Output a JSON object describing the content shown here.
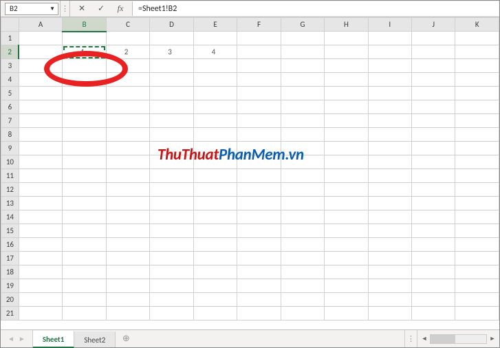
{
  "nameBox": {
    "value": "B2"
  },
  "formulaBar": {
    "cancel": "✕",
    "enter": "✓",
    "fx": "fx",
    "formula": "=Sheet1!B2"
  },
  "grid": {
    "columns": [
      "A",
      "B",
      "C",
      "D",
      "E",
      "F",
      "G",
      "H",
      "I",
      "J",
      "K"
    ],
    "rowCount": 21,
    "selectedCol": "B",
    "selectedRow": 2,
    "cells": {
      "B2": "1",
      "C2": "2",
      "D2": "3",
      "E2": "4"
    }
  },
  "watermark": {
    "part1": "ThuThuat",
    "part2": "PhanMem.vn"
  },
  "tabs": {
    "items": [
      {
        "label": "Sheet1",
        "active": true
      },
      {
        "label": "Sheet2",
        "active": false
      }
    ],
    "add": "⊕"
  }
}
